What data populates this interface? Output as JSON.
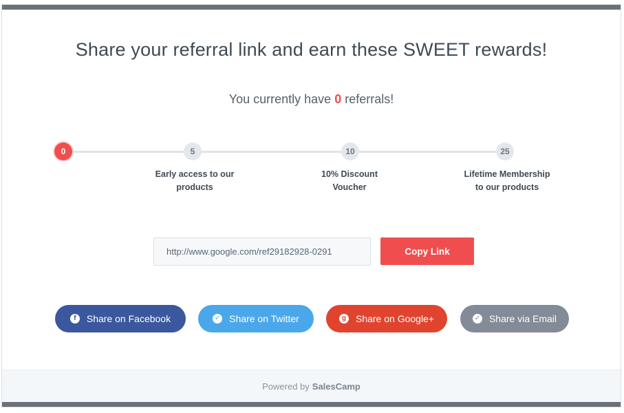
{
  "headline": "Share your referral link and earn these SWEET rewards!",
  "status": {
    "prefix": "You currently have",
    "count": "0",
    "suffix": "referrals!"
  },
  "milestones": [
    {
      "value": "0",
      "label_line1": "",
      "label_line2": ""
    },
    {
      "value": "5",
      "label_line1": "Early access to our",
      "label_line2": "products"
    },
    {
      "value": "10",
      "label_line1": "10% Discount",
      "label_line2": "Voucher"
    },
    {
      "value": "25",
      "label_line1": "Lifetime Membership",
      "label_line2": "to our products"
    }
  ],
  "referral_link": {
    "value": "http://www.google.com/ref29182928-0291",
    "copy_label": "Copy Link"
  },
  "share_buttons": {
    "facebook": {
      "label": "Share on Facebook",
      "icon": "facebook-icon",
      "color": "#3b579d"
    },
    "twitter": {
      "label": "Share on Twitter",
      "icon": "twitter-icon",
      "color": "#4aa8ea"
    },
    "google": {
      "label": "Share on Google+",
      "icon": "google-plus-icon",
      "color": "#e0442e"
    },
    "email": {
      "label": "Share via Email",
      "icon": "email-icon",
      "color": "#828b97"
    }
  },
  "footer": {
    "powered_by": "Powered by",
    "brand": "SalesCamp"
  },
  "colors": {
    "accent": "#f04e4e",
    "text": "#3f4a53",
    "frame": "#6b7178"
  }
}
